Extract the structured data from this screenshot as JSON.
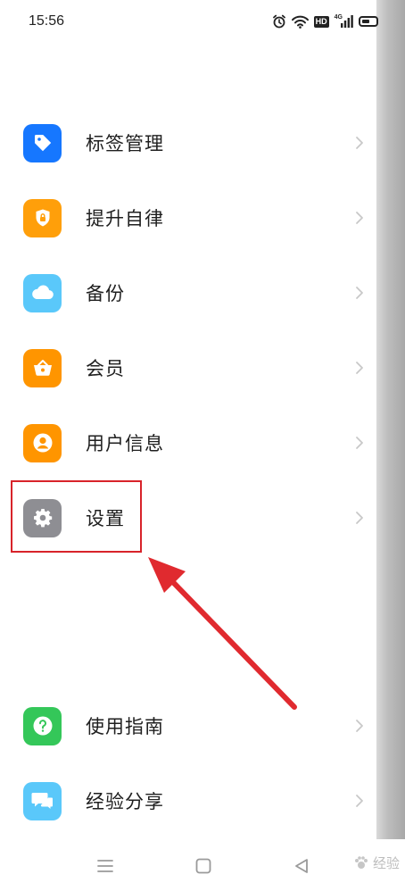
{
  "status_bar": {
    "time": "15:56",
    "icons": [
      "alarm-icon",
      "wifi-icon",
      "hd-icon",
      "signal-4g-icon",
      "battery-icon"
    ],
    "hd_label": "HD",
    "network_label": "4G",
    "battery_level": 0.55
  },
  "menu": {
    "items": [
      {
        "label": "标签管理",
        "icon": "tag-icon",
        "color": "#1677ff"
      },
      {
        "label": "提升自律",
        "icon": "shield-lock-icon",
        "color": "#ff9f0a"
      },
      {
        "label": "备份",
        "icon": "cloud-icon",
        "color": "#5ac8fa"
      },
      {
        "label": "会员",
        "icon": "basket-icon",
        "color": "#ff9500"
      },
      {
        "label": "用户信息",
        "icon": "user-icon",
        "color": "#ff9500"
      },
      {
        "label": "设置",
        "icon": "gear-icon",
        "color": "#8e8e93"
      },
      {
        "label": "使用指南",
        "icon": "help-icon",
        "color": "#34c759"
      },
      {
        "label": "经验分享",
        "icon": "chat-icon",
        "color": "#5ac8fa"
      }
    ]
  },
  "annotation": {
    "color": "#d8232a",
    "target": "设置"
  },
  "nav_bar": {
    "buttons": [
      "menu-icon",
      "home-square-icon",
      "back-triangle-icon"
    ]
  },
  "watermark": {
    "text": "经验"
  }
}
